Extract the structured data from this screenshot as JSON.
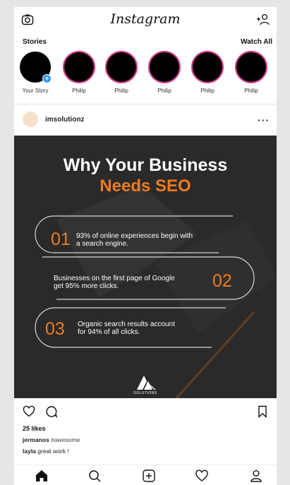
{
  "header": {
    "app_title": "Instagram"
  },
  "stories": {
    "label": "Stories",
    "watch_all": "Watch All",
    "items": [
      {
        "name": "Your Story"
      },
      {
        "name": "Philip"
      },
      {
        "name": "Philip"
      },
      {
        "name": "Philip"
      },
      {
        "name": "Philip"
      },
      {
        "name": "Philip"
      }
    ]
  },
  "post": {
    "username": "imsolutionz",
    "more": "···",
    "image": {
      "title_line1": "Why Your Business",
      "title_line2": "Needs SEO",
      "stats": [
        {
          "num": "01",
          "text_line1": "93% of online experiences begin with",
          "text_line2": "a search engine."
        },
        {
          "num": "02",
          "text_line1": "Businesses on the first page of Google",
          "text_line2": "get 95% more clicks."
        },
        {
          "num": "03",
          "text_line1": "Organic search results account",
          "text_line2": "for 94% of all clicks."
        }
      ],
      "logo_text": "SOLUTIONS"
    },
    "likes": "25 likes",
    "caption_user": "jermanos",
    "caption_text": "#awesome",
    "comment_user": "layla",
    "comment_text": "great work !"
  },
  "colors": {
    "accent_orange": "#f07b1f",
    "story_ring": "#d6398b",
    "badge_blue": "#3897f0"
  },
  "nav": {
    "items": [
      "home-icon",
      "search-icon",
      "add-post-icon",
      "activity-heart-icon",
      "profile-icon"
    ]
  }
}
